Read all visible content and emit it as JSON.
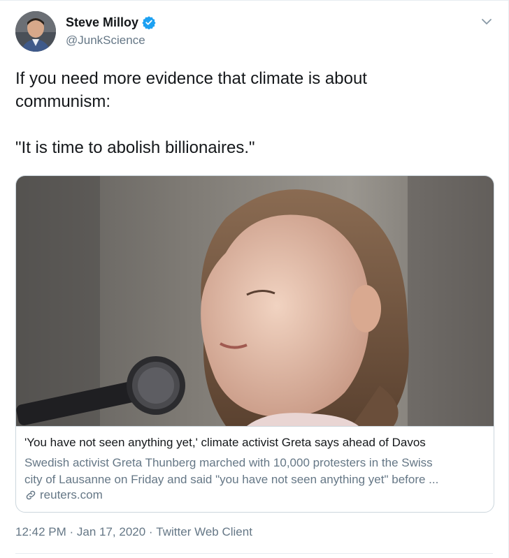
{
  "author": {
    "name": "Steve Milloy",
    "handle": "@JunkScience",
    "verified": true
  },
  "tweet": {
    "line1": "If you need more evidence that climate is about",
    "line2": "communism:",
    "line3": "\"It is time to abolish billionaires.\""
  },
  "card": {
    "title": "'You have not seen anything yet,' climate activist Greta says ahead of Davos",
    "description_line1": "Swedish activist Greta Thunberg marched with 10,000 protesters in the Swiss",
    "description_line2": "city of Lausanne on Friday and said \"you have not seen anything yet\" before ...",
    "domain": "reuters.com"
  },
  "meta": {
    "time": "12:42 PM",
    "separator": " · ",
    "date": "Jan 17, 2020",
    "client": "Twitter Web Client"
  },
  "colors": {
    "text": "#14171a",
    "secondary": "#657786",
    "verified_blue": "#1da1f2",
    "border": "#ccd6dd"
  },
  "icons": {
    "verified": "verified-badge-icon",
    "menu": "chevron-down-icon",
    "link": "link-icon"
  }
}
